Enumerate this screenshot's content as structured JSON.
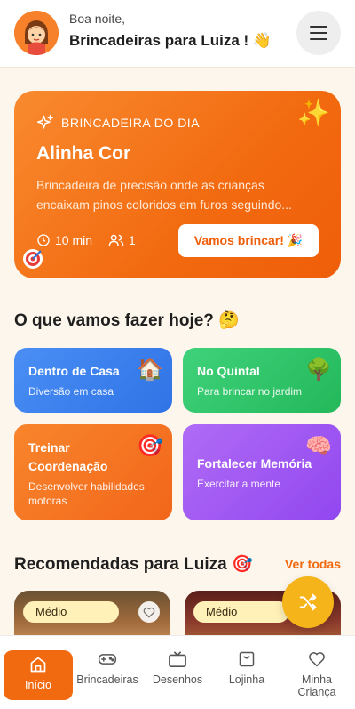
{
  "header": {
    "greeting": "Boa noite,",
    "title": "Brincadeiras para Luiza ! 👋"
  },
  "hero": {
    "tag": "BRINCADEIRA DO DIA",
    "title": "Alinha Cor",
    "description": "Brincadeira de precisão onde as crianças encaixam pinos coloridos em furos seguindo...",
    "duration": "10 min",
    "players": "1",
    "cta": "Vamos brincar! 🎉",
    "sparkle": "✨"
  },
  "section_today": {
    "title": "O que vamos fazer hoje? 🤔"
  },
  "categories": [
    {
      "title": "Dentro de Casa",
      "subtitle": "Diversão em casa",
      "emoji": "🏠",
      "color": "#3d82f0"
    },
    {
      "title": "No Quintal",
      "subtitle": "Para brincar no jardim",
      "emoji": "🌳",
      "color": "#2ec869"
    },
    {
      "title": "Treinar Coordenação",
      "subtitle": "Desenvolver habilidades motoras",
      "emoji": "🎯",
      "color": "#f6761f"
    },
    {
      "title": "Fortalecer Memória",
      "subtitle": "Exercitar a mente",
      "emoji": "🧠",
      "color": "#a158f2"
    }
  ],
  "section_recommended": {
    "title": "Recomendadas para Luiza 🎯",
    "see_all": "Ver todas"
  },
  "recommendations": [
    {
      "level": "Médio"
    },
    {
      "level": "Médio"
    }
  ],
  "nav": [
    {
      "label": "Início",
      "icon": "home-icon"
    },
    {
      "label": "Brincadeiras",
      "icon": "gamepad-icon"
    },
    {
      "label": "Desenhos",
      "icon": "tv-icon"
    },
    {
      "label": "Lojinha",
      "icon": "shopping-bag-icon"
    },
    {
      "label": "Minha Criança",
      "icon": "heart-icon"
    }
  ],
  "colors": {
    "accent": "#f26a10",
    "fab": "#f4b41a"
  }
}
